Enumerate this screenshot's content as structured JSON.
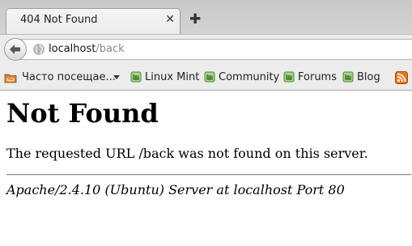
{
  "tab": {
    "title": "404 Not Found",
    "close_glyph": "✕",
    "new_tab_glyph": "✚"
  },
  "navigation": {
    "back_icon": "back-arrow-icon",
    "site_icon": "globe-icon",
    "url_host": "localhost",
    "url_path": "/back"
  },
  "bookmarks": {
    "items": [
      {
        "label": "Часто посещае...",
        "icon": "folder-icon",
        "dropdown": true
      },
      {
        "label": "Linux Mint",
        "icon": "mint-icon"
      },
      {
        "label": "Community",
        "icon": "mint-icon"
      },
      {
        "label": "Forums",
        "icon": "mint-icon"
      },
      {
        "label": "Blog",
        "icon": "mint-icon"
      },
      {
        "label": "",
        "icon": "rss-icon"
      }
    ]
  },
  "page": {
    "heading": "Not Found",
    "message": "The requested URL /back was not found on this server.",
    "server_signature": "Apache/2.4.10 (Ubuntu) Server at localhost Port 80"
  },
  "colors": {
    "mint_green": "#6aa84f",
    "rss_orange": "#e8751a",
    "folder_orange": "#d9822b"
  }
}
